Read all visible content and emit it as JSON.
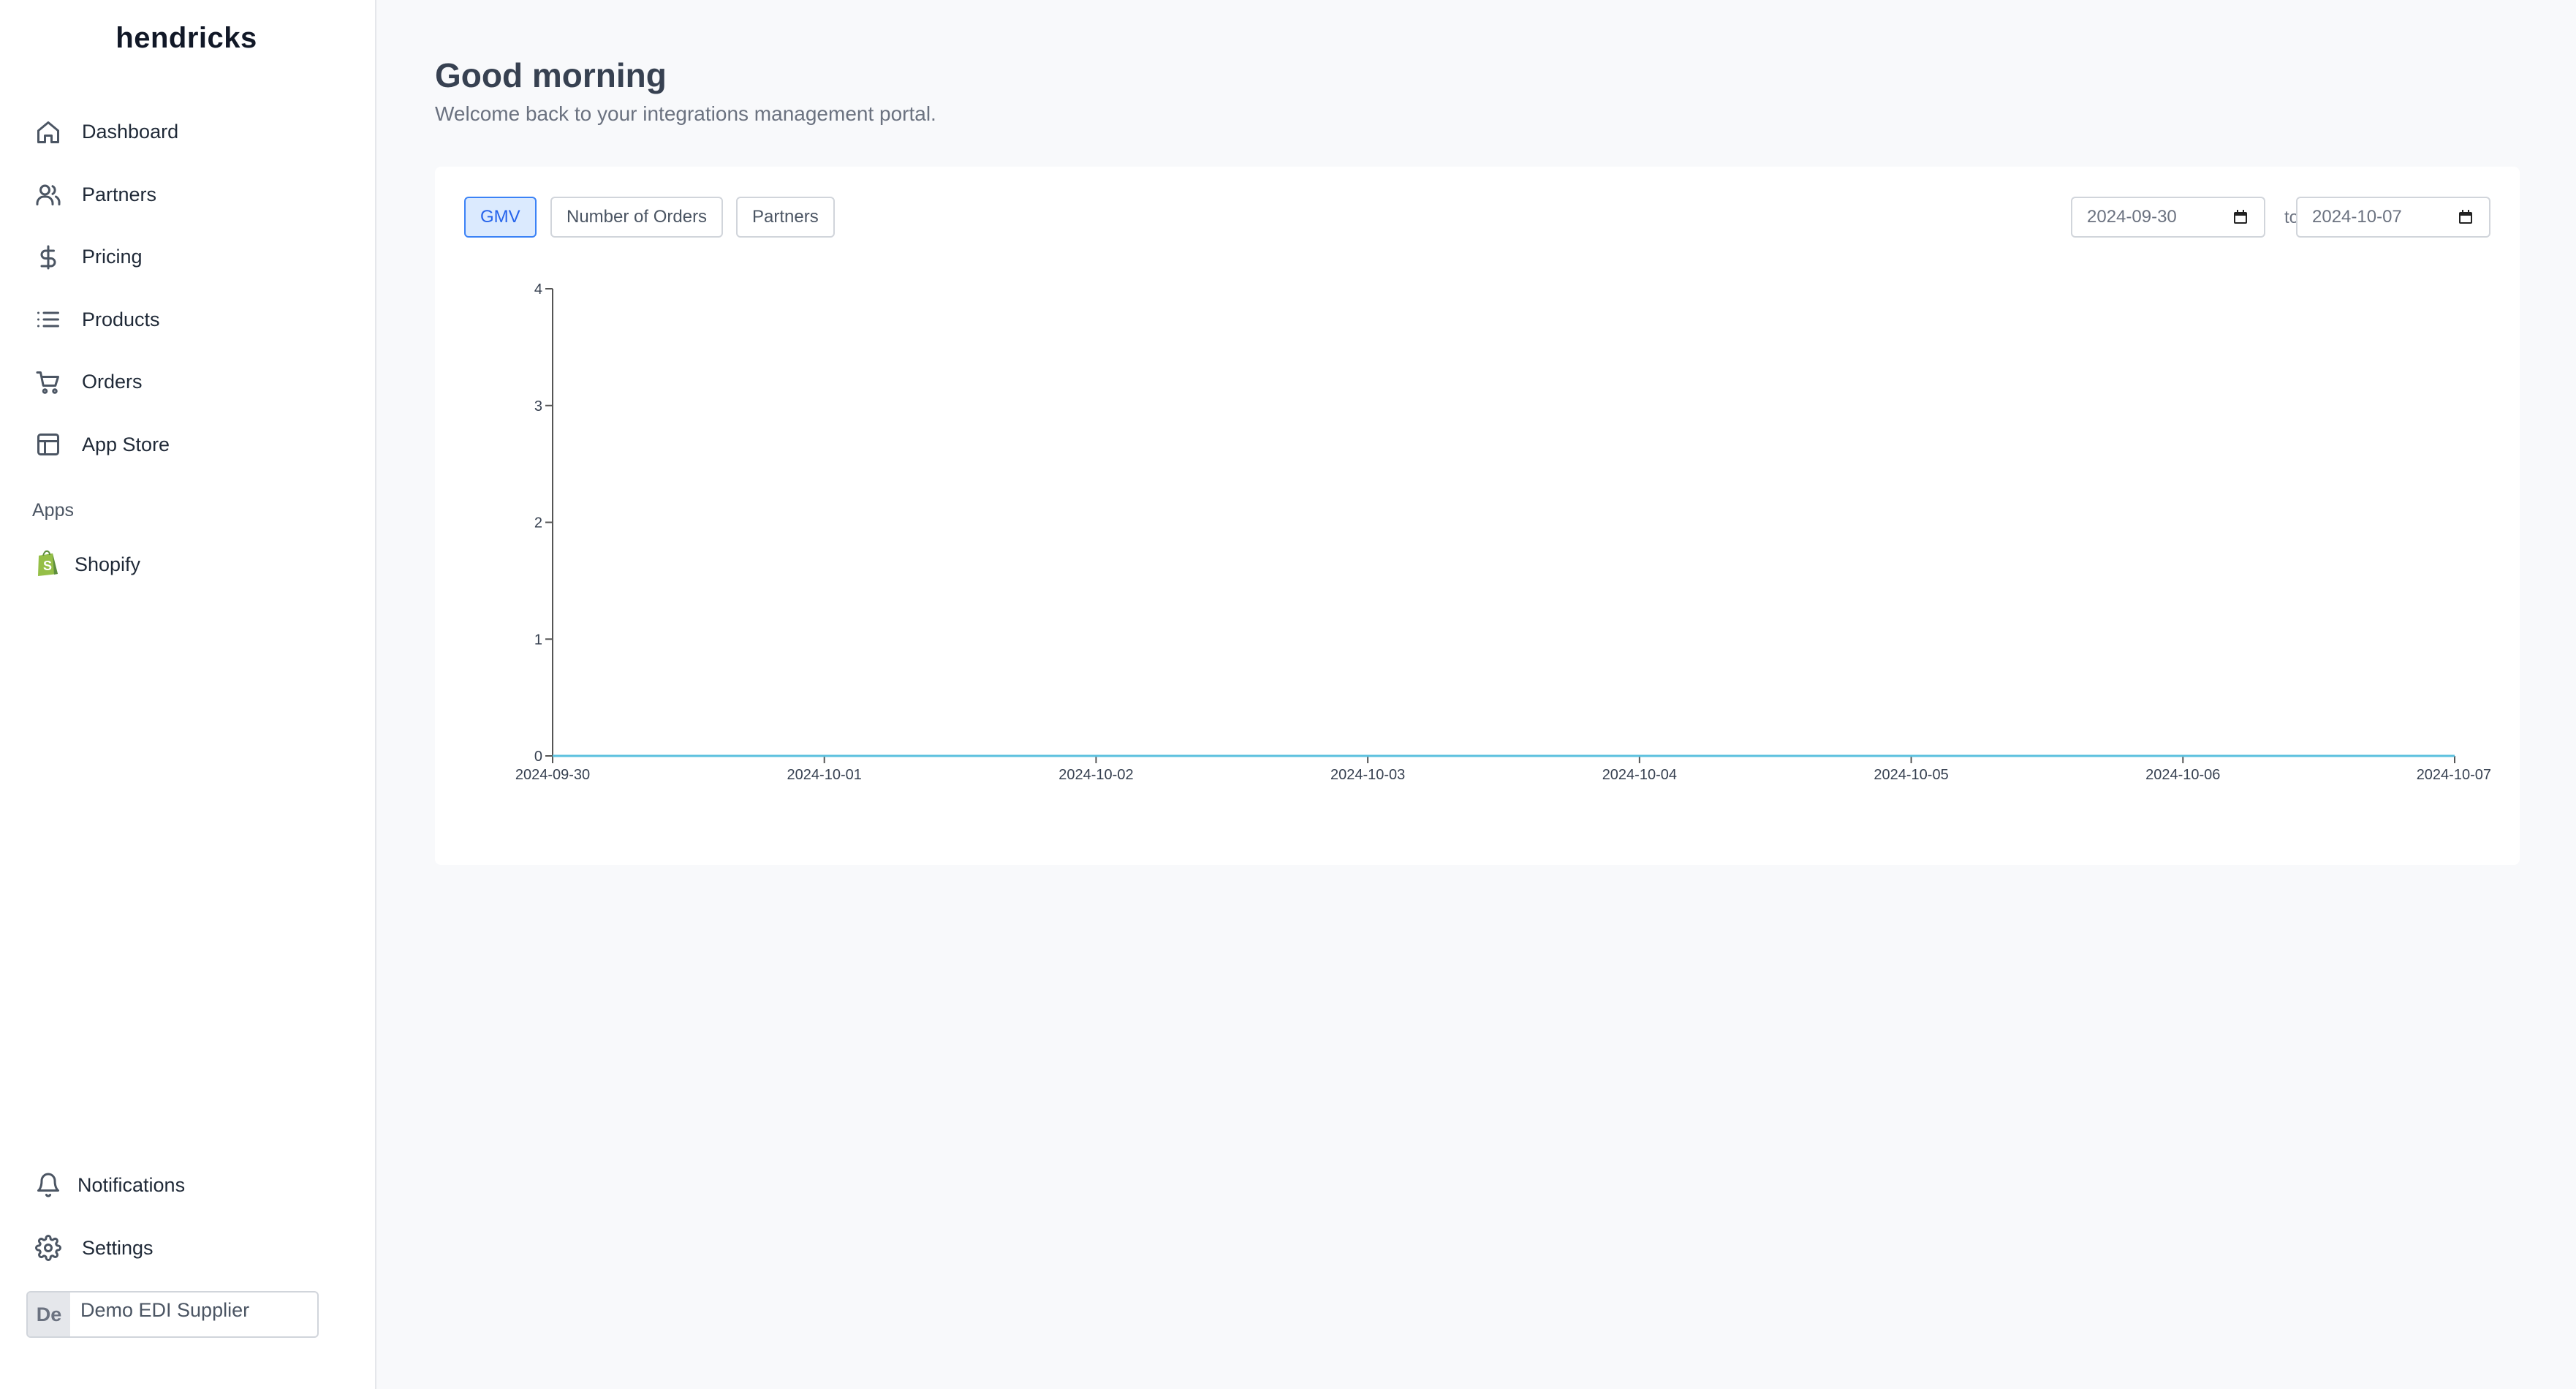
{
  "sidebar": {
    "brand": "hendricks",
    "nav": [
      {
        "label": "Dashboard",
        "icon": "home-icon"
      },
      {
        "label": "Partners",
        "icon": "users-icon"
      },
      {
        "label": "Pricing",
        "icon": "dollar-icon"
      },
      {
        "label": "Products",
        "icon": "list-icon"
      },
      {
        "label": "Orders",
        "icon": "cart-icon"
      },
      {
        "label": "App Store",
        "icon": "layout-icon"
      }
    ],
    "apps_title": "Apps",
    "apps": [
      {
        "label": "Shopify",
        "icon": "shopify-icon"
      }
    ],
    "bottom_nav": [
      {
        "label": "Notifications",
        "icon": "bell-icon"
      },
      {
        "label": "Settings",
        "icon": "gear-icon"
      }
    ],
    "supplier": {
      "initials": "De",
      "name": "Demo EDI Supplier"
    }
  },
  "main": {
    "greeting": "Good morning",
    "subtitle": "Welcome back to your integrations management portal.",
    "tabs": [
      {
        "label": "GMV",
        "active": true
      },
      {
        "label": "Number of Orders",
        "active": false
      },
      {
        "label": "Partners",
        "active": false
      }
    ],
    "date_from": "2024-09-30",
    "date_to": "2024-10-07",
    "date_separator": "to"
  },
  "chart_data": {
    "type": "line",
    "x": [
      "2024-09-30",
      "2024-10-01",
      "2024-10-02",
      "2024-10-03",
      "2024-10-04",
      "2024-10-05",
      "2024-10-06",
      "2024-10-07"
    ],
    "series": [
      {
        "values": [
          0,
          0,
          0,
          0,
          0,
          0,
          0,
          0
        ]
      }
    ],
    "ylim": [
      0,
      4
    ],
    "yticks": [
      0,
      1,
      2,
      3,
      4
    ],
    "grid": false,
    "line_color": "#5bc0de"
  }
}
